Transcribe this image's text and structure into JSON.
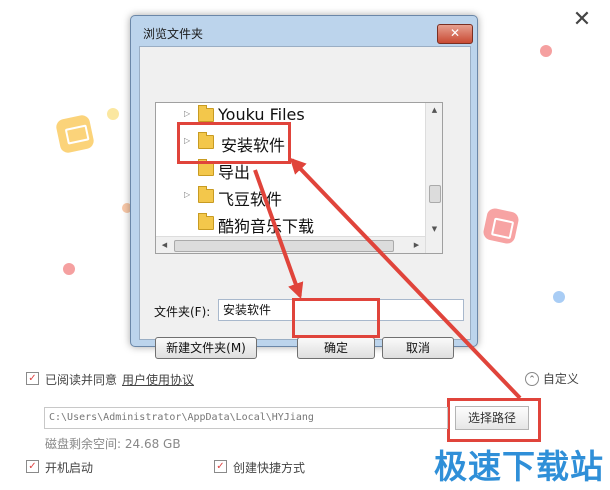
{
  "app": {
    "close_glyph": "✕"
  },
  "dialog": {
    "title": "浏览文件夹",
    "close_glyph": "✕",
    "tree": {
      "items": [
        {
          "label": "Youku Files",
          "expandable": true,
          "selected": false
        },
        {
          "label": "安装软件",
          "expandable": true,
          "selected": true
        },
        {
          "label": "导出",
          "expandable": false,
          "selected": false
        },
        {
          "label": "飞豆软件",
          "expandable": true,
          "selected": false
        },
        {
          "label": "酷狗音乐下载",
          "expandable": false,
          "selected": false
        }
      ]
    },
    "folder_field": {
      "label": "文件夹(F):",
      "value": "安装软件"
    },
    "buttons": {
      "new_folder": "新建文件夹(M)",
      "ok": "确定",
      "cancel": "取消"
    }
  },
  "install": {
    "agree": {
      "checked": true,
      "text": "已阅读并同意",
      "link": "用户使用协议"
    },
    "custom": {
      "glyph": "⌃",
      "label": "自定义"
    },
    "path": "C:\\Users\\Administrator\\AppData\\Local\\HYJiang",
    "choose_path": "选择路径",
    "disk_space": "磁盘剩余空间: 24.68 GB",
    "options": [
      {
        "label": "开机启动",
        "checked": true
      },
      {
        "label": "创建快捷方式",
        "checked": true
      }
    ]
  },
  "watermark": "极速下载站",
  "colors": {
    "annotation_red": "#e0443b",
    "watermark_blue": "#2f8fd8",
    "dialog_frame": "#bcd4ec"
  }
}
